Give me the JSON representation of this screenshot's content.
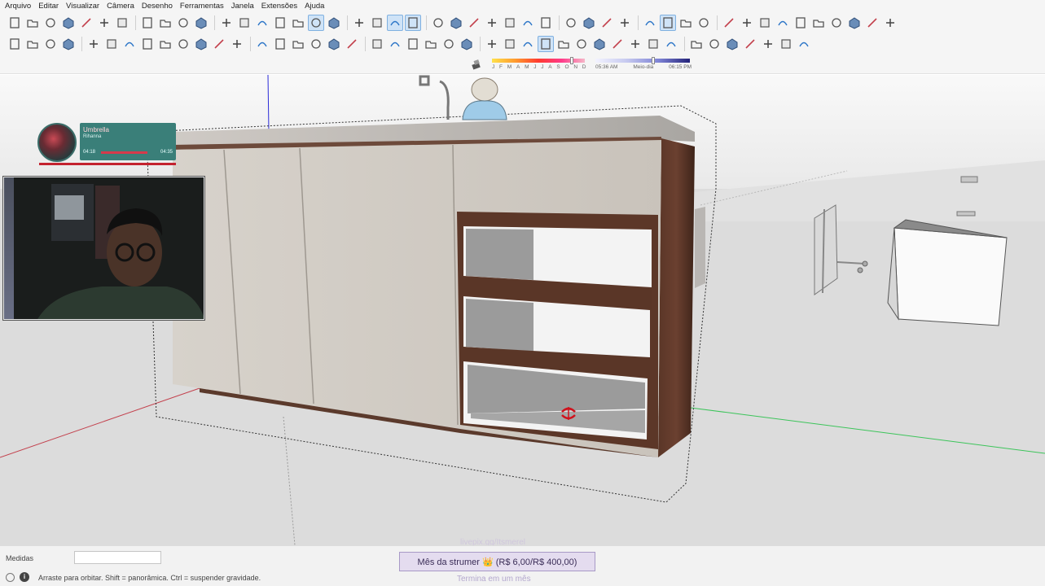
{
  "menu": [
    "Arquivo",
    "Editar",
    "Visualizar",
    "Câmera",
    "Desenho",
    "Ferramentas",
    "Janela",
    "Extensões",
    "Ajuda"
  ],
  "toolbar1": [
    {
      "name": "new-file-icon"
    },
    {
      "name": "open-folder-icon"
    },
    {
      "name": "save-icon"
    },
    {
      "name": "cut-icon"
    },
    {
      "name": "copy-icon"
    },
    {
      "name": "paste-icon"
    },
    {
      "name": "delete-icon"
    },
    {
      "sep": true
    },
    {
      "name": "undo-icon"
    },
    {
      "name": "redo-icon"
    },
    {
      "name": "print-icon"
    },
    {
      "name": "model-info-icon"
    },
    {
      "sep": true
    },
    {
      "name": "xray-style-icon"
    },
    {
      "name": "backedges-style-icon"
    },
    {
      "name": "wireframe-style-icon"
    },
    {
      "name": "hidden-line-style-icon"
    },
    {
      "name": "shaded-style-icon"
    },
    {
      "name": "shaded-textures-style-icon",
      "active": true
    },
    {
      "name": "monochrome-style-icon"
    },
    {
      "sep": true
    },
    {
      "name": "iso-view-icon"
    },
    {
      "name": "top-view-icon"
    },
    {
      "name": "front-view-icon",
      "active": true
    },
    {
      "name": "right-view-icon",
      "active": true
    },
    {
      "sep": true
    },
    {
      "name": "back-view-icon"
    },
    {
      "name": "left-view-icon"
    },
    {
      "name": "section-plane-icon"
    },
    {
      "name": "section-fill-icon"
    },
    {
      "name": "section-cut-icon"
    },
    {
      "name": "section-display-icon"
    },
    {
      "name": "section-planes-icon"
    },
    {
      "sep": true
    },
    {
      "name": "outer-shell-icon"
    },
    {
      "name": "intersect-icon"
    },
    {
      "name": "union-icon"
    },
    {
      "name": "subtract-icon"
    },
    {
      "sep": true
    },
    {
      "name": "components-icon"
    },
    {
      "name": "dynamic-components-icon",
      "active": true
    },
    {
      "name": "component-options-icon"
    },
    {
      "name": "warehouse-icon"
    },
    {
      "sep": true
    },
    {
      "name": "add-location-icon"
    },
    {
      "name": "sandbox-icon"
    },
    {
      "name": "terrain-icon"
    },
    {
      "name": "geo-location-icon"
    },
    {
      "name": "cloud-icon"
    },
    {
      "name": "extension-manager-icon"
    },
    {
      "name": "export-icon"
    },
    {
      "name": "info-icon"
    },
    {
      "name": "shop-icon"
    },
    {
      "name": "account-icon"
    }
  ],
  "toolbar2": [
    {
      "name": "select-tool-icon"
    },
    {
      "name": "paint-bucket-icon"
    },
    {
      "name": "make-component-icon"
    },
    {
      "name": "eraser-icon"
    },
    {
      "sep": true
    },
    {
      "name": "line-tool-icon"
    },
    {
      "name": "freehand-tool-icon"
    },
    {
      "name": "rectangle-tool-icon"
    },
    {
      "name": "rotated-rectangle-icon"
    },
    {
      "name": "circle-tool-icon"
    },
    {
      "name": "polygon-tool-icon"
    },
    {
      "name": "arc-tool-icon"
    },
    {
      "name": "two-point-arc-icon"
    },
    {
      "name": "pie-tool-icon"
    },
    {
      "sep": true
    },
    {
      "name": "move-tool-icon"
    },
    {
      "name": "push-pull-icon"
    },
    {
      "name": "rotate-tool-icon"
    },
    {
      "name": "follow-me-icon"
    },
    {
      "name": "scale-tool-icon"
    },
    {
      "name": "offset-tool-icon"
    },
    {
      "sep": true
    },
    {
      "name": "tape-measure-icon"
    },
    {
      "name": "dimension-icon"
    },
    {
      "name": "protractor-icon"
    },
    {
      "name": "text-tool-icon"
    },
    {
      "name": "axes-tool-icon"
    },
    {
      "name": "3d-text-icon"
    },
    {
      "sep": true
    },
    {
      "name": "walk-icon"
    },
    {
      "name": "position-camera-icon"
    },
    {
      "name": "look-around-icon"
    },
    {
      "name": "orbit-icon",
      "active": true
    },
    {
      "name": "pan-icon"
    },
    {
      "name": "zoom-icon"
    },
    {
      "name": "zoom-window-icon"
    },
    {
      "name": "zoom-extents-icon"
    },
    {
      "name": "previous-view-icon"
    },
    {
      "name": "section-tool-icon"
    },
    {
      "name": "walkthrough-icon"
    },
    {
      "sep": true
    },
    {
      "name": "solid-tools-icon"
    },
    {
      "name": "box-icon"
    },
    {
      "name": "solid-box-icon"
    },
    {
      "name": "mirror-icon"
    },
    {
      "name": "curviloft-icon"
    },
    {
      "name": "layout-icon"
    },
    {
      "name": "grid-icon"
    }
  ],
  "shadows": {
    "months": "J F M A M J J A S O N D",
    "time_start": "05:36 AM",
    "time_mid": "Meio-dia",
    "time_end": "06:15 PM",
    "month_pos": 0.87,
    "time_pos": 0.62
  },
  "music": {
    "title": "Umbrella",
    "artist": "Rihanna",
    "time_start": "04:18",
    "time_end": "04:35",
    "progress": 0.95
  },
  "watermark": "livepix.gg/Itsmerel",
  "status": {
    "measure_label": "Medidas",
    "measure_value": "",
    "hint": "Arraste para orbitar. Shift = panorâmica. Ctrl = suspender gravidade.",
    "goal": "Mês da strumer 👑 (R$ 6,00/R$ 400,00)",
    "goal_sub": "Termina em um mês"
  },
  "colors": {
    "ground": "#dedede",
    "sky": "#f7f7f7",
    "cabinet_front": "#cfcac3",
    "cabinet_side": "#4d2e22",
    "countertop": "#b9b6b2",
    "accent": "#3a7f79"
  }
}
